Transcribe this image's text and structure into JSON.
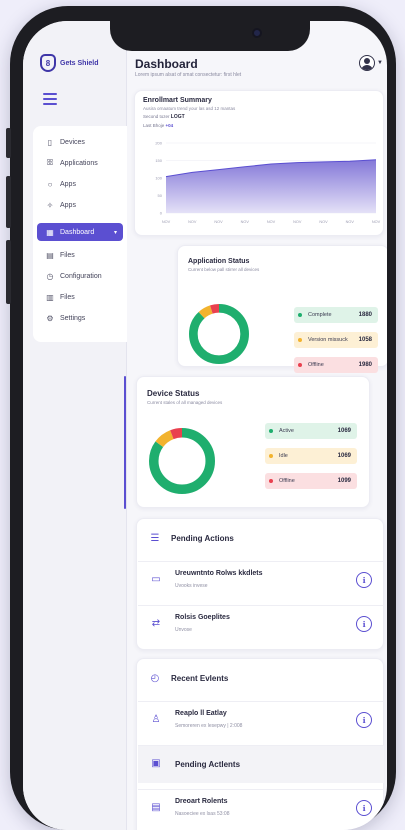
{
  "app": {
    "name": "Gets Shield",
    "logo_glyph": "8"
  },
  "header": {
    "title": "Dashboard",
    "subtitle": "Lorem ipsum alsat of smat consectetur: first hlet"
  },
  "sidebar": {
    "items": [
      {
        "label": "Devices",
        "icon": "device-icon",
        "glyph": "▯"
      },
      {
        "label": "Applications",
        "icon": "users-icon",
        "glyph": "ꕥ"
      },
      {
        "label": "Apps",
        "icon": "circle-icon",
        "glyph": "○"
      },
      {
        "label": "Apps",
        "icon": "sparkle-icon",
        "glyph": "✧"
      },
      {
        "label": "Dashboard",
        "icon": "grid-icon",
        "glyph": "▦",
        "active": true
      },
      {
        "label": "Files",
        "icon": "file-icon",
        "glyph": "▤"
      },
      {
        "label": "Configuration",
        "icon": "clock-icon",
        "glyph": "◷"
      },
      {
        "label": "Files",
        "icon": "document-icon",
        "glyph": "▥"
      },
      {
        "label": "Settings",
        "icon": "gear-icon",
        "glyph": "⚙"
      }
    ]
  },
  "enrollment": {
    "title": "Enrollmart Summary",
    "subtitle": "Ausira ornaatum trend your las asd 12 mantas",
    "stat1_label": "Second tozer",
    "stat1_value": "LOGT",
    "stat2_label": "Last Bhoje",
    "stat2_value": "+04"
  },
  "chart_data": {
    "type": "area",
    "x": [
      "NOV",
      "NOV",
      "NOV",
      "NOV",
      "NOV",
      "NOV",
      "NOV",
      "NOV",
      "NOV"
    ],
    "series": [
      {
        "values": [
          52,
          58,
          62,
          66,
          70,
          72,
          73,
          74,
          76
        ]
      }
    ],
    "yticks": [
      "200",
      "150",
      "100",
      "50",
      "0"
    ],
    "ylim": [
      0,
      100
    ],
    "grid": true,
    "colors": {
      "fill_top": "#8478d8",
      "fill_bottom": "#e4e1f7",
      "line": "#5b4fd1"
    }
  },
  "app_status": {
    "title": "Application Status",
    "subtitle": "Current below pall stirrer all devices",
    "legend": [
      {
        "label": "Complete",
        "value": "1880",
        "color": "#1fae6e",
        "bg": "#dff3e8"
      },
      {
        "label": "Version missuck",
        "value": "1058",
        "color": "#f2b32e",
        "bg": "#fdf0d5"
      },
      {
        "label": "Offline",
        "value": "1980",
        "color": "#e9414f",
        "bg": "#fbdfe1"
      }
    ],
    "donut": [
      88,
      7,
      5
    ]
  },
  "device_status": {
    "title": "Device Status",
    "subtitle": "Current stales of all managed devices",
    "legend": [
      {
        "label": "Active",
        "value": "1069",
        "color": "#1fae6e",
        "bg": "#dff3e8"
      },
      {
        "label": "Idle",
        "value": "1069",
        "color": "#f2b32e",
        "bg": "#fdf0d5"
      },
      {
        "label": "Offline",
        "value": "1099",
        "color": "#e9414f",
        "bg": "#fbdfe1"
      }
    ],
    "donut": [
      85,
      9,
      6
    ]
  },
  "pending": {
    "title": "Pending Actions",
    "rows": [
      {
        "title": "Ureuwntnto Rolws kkdlets",
        "sub": "Uvooks invese"
      },
      {
        "title": "Rolsis Goeplites",
        "sub": "Unvose"
      }
    ]
  },
  "recent": {
    "title": "Recent Evlents",
    "rows": [
      {
        "title": "Reaplo ll Eatlay",
        "sub": "Semoreren ex lesepwy | 2:008"
      },
      {
        "title": "Pending Actlents",
        "sub": ""
      },
      {
        "title": "Dreoart Rolents",
        "sub": "Nasoeciee ex lsas 53:08"
      }
    ]
  }
}
